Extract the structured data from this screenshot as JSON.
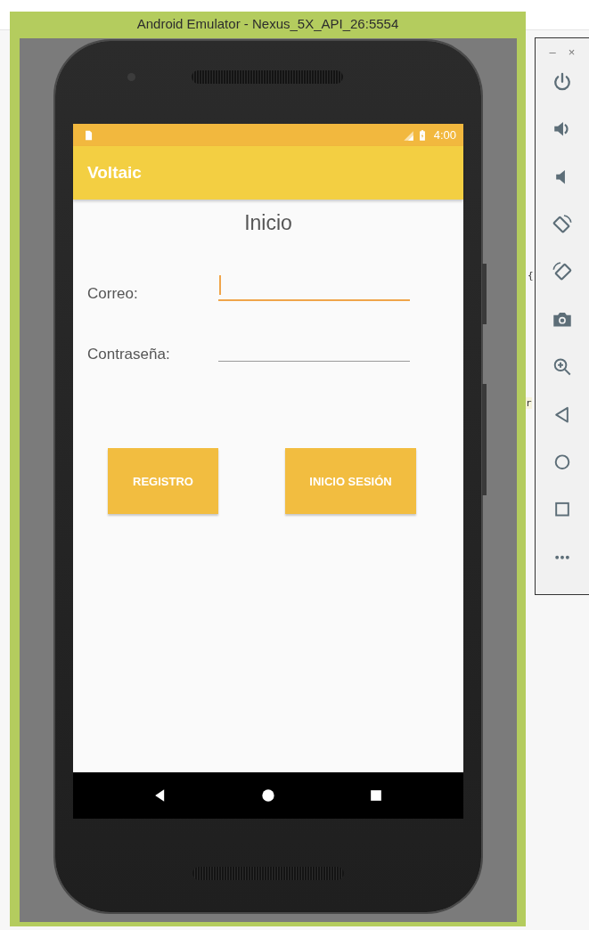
{
  "window": {
    "title": "Android Emulator - Nexus_5X_API_26:5554"
  },
  "status_bar": {
    "time": "4:00"
  },
  "app_bar": {
    "title": "Voltaic"
  },
  "screen_title": "Inicio",
  "fields": [
    {
      "label": "Correo:",
      "focused": true
    },
    {
      "label": "Contraseña:",
      "focused": false
    }
  ],
  "buttons": [
    "REGISTRO",
    "INICIO SESIÓN"
  ],
  "nav_bar": [
    {
      "kind": "back"
    },
    {
      "kind": "home"
    },
    {
      "kind": "recents"
    }
  ],
  "side_toolbar": {
    "window_controls": [
      "–",
      "×"
    ],
    "tools": [
      {
        "kind": "power"
      },
      {
        "kind": "volume_up"
      },
      {
        "kind": "volume_down"
      },
      {
        "kind": "rotate_left"
      },
      {
        "kind": "rotate_right"
      },
      {
        "kind": "camera"
      },
      {
        "kind": "zoom"
      },
      {
        "kind": "back"
      },
      {
        "kind": "home"
      },
      {
        "kind": "overview"
      },
      {
        "kind": "more"
      }
    ]
  },
  "background_text": [
    "{",
    "r"
  ]
}
